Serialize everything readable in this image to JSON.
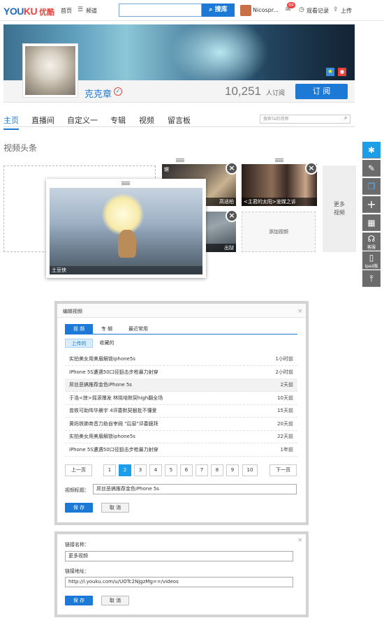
{
  "navbar": {
    "logo_text": "YOU",
    "logo_ku": "KU",
    "logo_cn": "优酷",
    "home": "首页",
    "channels": "频道",
    "search_btn": "搜库",
    "user_name": "Nicospr...",
    "msg_count": "99",
    "history": "观看记录",
    "upload": "上传"
  },
  "profile": {
    "channel_name": "克克章",
    "sub_count": "10,251",
    "sub_label": "人订阅",
    "sub_btn": "订 阅"
  },
  "tabs": {
    "items": [
      "主页",
      "直播间",
      "自定义一",
      "专辑",
      "视频",
      "留言板"
    ],
    "search_placeholder": "搜索Ta的视频"
  },
  "headline": {
    "title": "视频头条",
    "dragging_caption": "土豆侠",
    "thumb1_caption": "高适柏",
    "thumb1_logo": "锵",
    "thumb2_caption": "<主君的太阳>宠媒之诉",
    "thumb3_caption": "出狱",
    "add_video": "添加视频",
    "more_video": "更多视频"
  },
  "right_toolbar": {
    "ipad_label": "Ipad版",
    "service_label": "客服"
  },
  "edit_dialog": {
    "title": "编辑视频",
    "tabs": [
      "视 频",
      "专 辑",
      "最近常用"
    ],
    "subtabs": [
      "上传的",
      "收藏的"
    ],
    "rows": [
      {
        "title": "实拍美女用美眉解锁iphone5s",
        "time": "1小时前"
      },
      {
        "title": "iPhone 5S遭遇50口径狙击步枪暴力射穿",
        "time": "2小时前"
      },
      {
        "title": "屌丝恶搞推荐金色iPhone 5s",
        "time": "2天前"
      },
      {
        "title": "于浩<掠>摇滚爆发 林晓培默契high翻全场",
        "time": "10天前"
      },
      {
        "title": "曾轶可助阵华晨宇 4评委默契狠批不懂爱",
        "time": "15天前"
      },
      {
        "title": "黄妈铁肺商音力助自宰阙 \"后窗\"评委膜拜",
        "time": "20天前"
      },
      {
        "title": "实拍美女用美眉解锁iphone5s",
        "time": "22天前"
      },
      {
        "title": "iPhone 5S遭遇50口径狙击步枪暴力射穿",
        "time": "1年前"
      }
    ],
    "prev": "上一页",
    "next": "下一页",
    "pages": [
      "1",
      "2",
      "3",
      "4",
      "5",
      "6",
      "7",
      "8",
      "9",
      "10"
    ],
    "title_label": "视频标题：",
    "title_value": "屌丝恶搞推荐金色iPhone 5s",
    "save": "保 存",
    "cancel": "取 消"
  },
  "link_dialog": {
    "name_label": "链接名称：",
    "name_value": "更多视频",
    "url_label": "链接地址：",
    "url_value": "http://i.youku.com/u/UOTc2NjgzMg==/videos",
    "save": "保 存",
    "cancel": "取 消"
  }
}
